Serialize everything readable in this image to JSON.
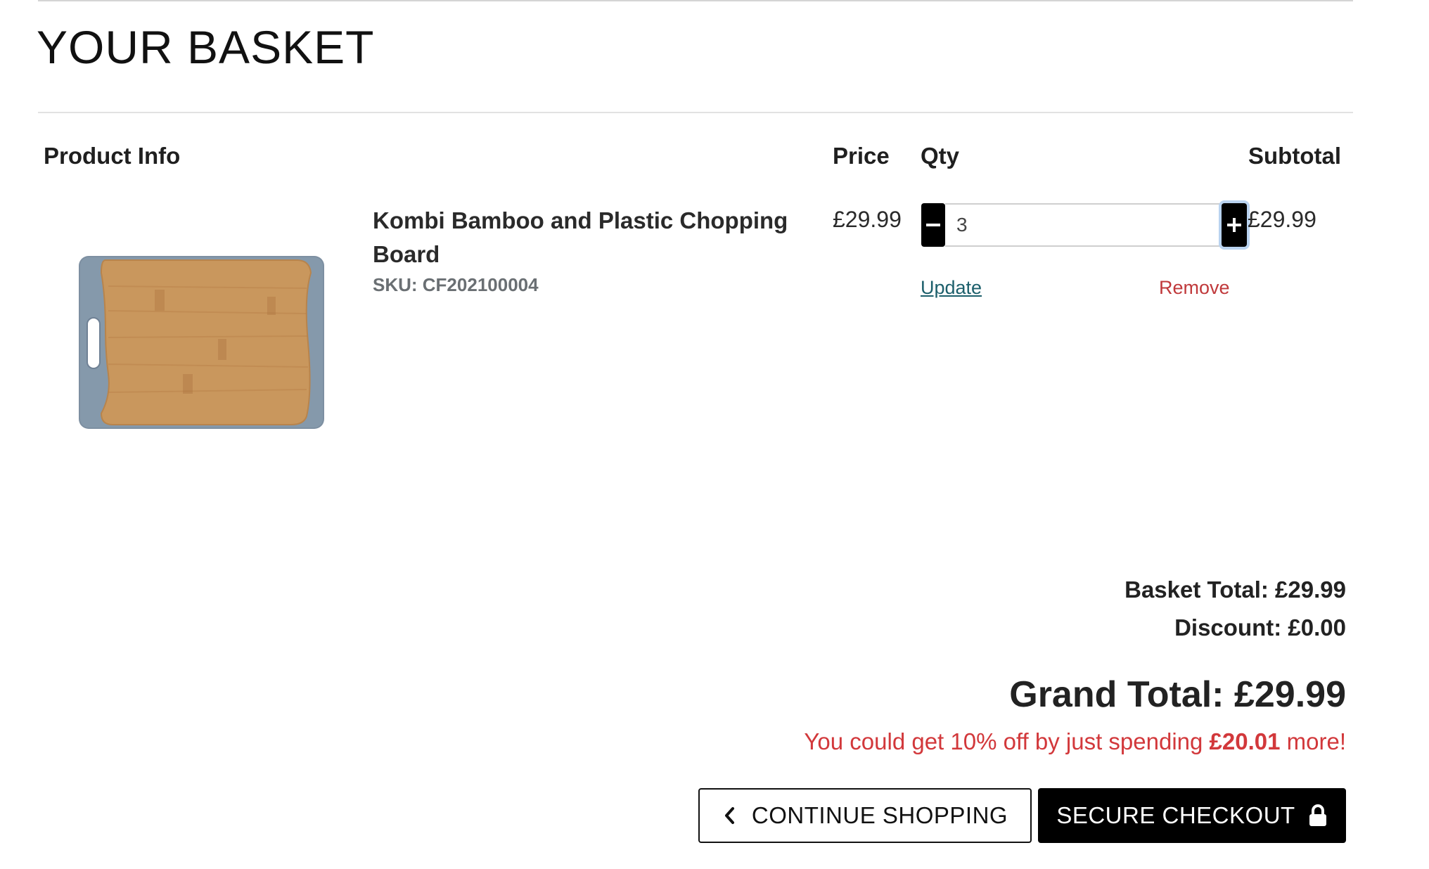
{
  "page_title": "YOUR BASKET",
  "table_headers": {
    "product_info": "Product Info",
    "price": "Price",
    "qty": "Qty",
    "subtotal": "Subtotal"
  },
  "items": [
    {
      "name": "Kombi Bamboo and Plastic Chopping Board",
      "sku": "SKU: CF202100004",
      "price": "£29.99",
      "quantity": "3",
      "subtotal": "£29.99",
      "image_icon": "chopping-board-image",
      "update_label": "Update",
      "remove_label": "Remove"
    }
  ],
  "summary": {
    "basket_total": "Basket Total: £29.99",
    "discount": "Discount: £0.00",
    "grand_total": "Grand Total: £29.99",
    "promo_prefix": "You could get 10% off by just spending ",
    "promo_amount": "£20.01",
    "promo_suffix": " more!"
  },
  "buttons": {
    "continue_label": "CONTINUE SHOPPING",
    "continue_icon": "chevron-left-icon",
    "checkout_label": "SECURE CHECKOUT",
    "checkout_icon": "lock-icon",
    "minus_icon": "minus-icon",
    "plus_icon": "plus-icon"
  },
  "colors": {
    "accent_link": "#1c5f6b",
    "remove": "#c0393b",
    "promo": "#d2383b",
    "button_dark": "#000000"
  }
}
